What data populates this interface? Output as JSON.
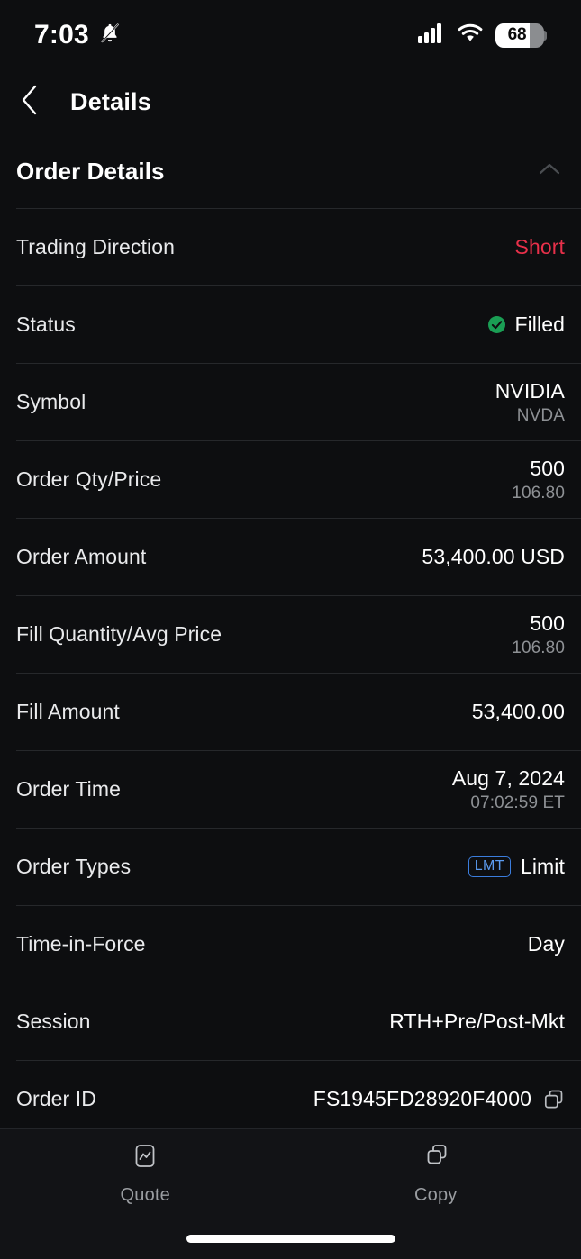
{
  "status_bar": {
    "time": "7:03",
    "bell_icon": "bell-muted-icon",
    "signal_icon": "cellular-signal-icon",
    "wifi_icon": "wifi-icon",
    "battery_percent": "68"
  },
  "nav": {
    "back_icon": "chevron-left-icon",
    "title": "Details"
  },
  "section": {
    "title": "Order Details",
    "collapse_icon": "chevron-up-icon"
  },
  "colors": {
    "background": "#0d0e10",
    "short_red": "#e8304a",
    "filled_green": "#1a9e54",
    "badge_blue": "#5b9bf0",
    "divider": "#26282b",
    "subvalue_gray": "#8e9195"
  },
  "rows": [
    {
      "label": "Trading Direction",
      "value": "Short",
      "sub": "",
      "style": "short"
    },
    {
      "label": "Status",
      "value": "Filled",
      "sub": "",
      "style": "status",
      "icon": "check-circle-icon"
    },
    {
      "label": "Symbol",
      "value": "NVIDIA",
      "sub": "NVDA",
      "style": "plain"
    },
    {
      "label": "Order Qty/Price",
      "value": "500",
      "sub": "106.80",
      "style": "plain"
    },
    {
      "label": "Order Amount",
      "value": "53,400.00 USD",
      "sub": "",
      "style": "plain"
    },
    {
      "label": "Fill Quantity/Avg Price",
      "value": "500",
      "sub": "106.80",
      "style": "plain"
    },
    {
      "label": "Fill Amount",
      "value": "53,400.00",
      "sub": "",
      "style": "plain"
    },
    {
      "label": "Order Time",
      "value": "Aug 7, 2024",
      "sub": "07:02:59 ET",
      "style": "plain"
    },
    {
      "label": "Order Types",
      "value": "Limit",
      "sub": "",
      "style": "badge",
      "badge": "LMT"
    },
    {
      "label": "Time-in-Force",
      "value": "Day",
      "sub": "",
      "style": "plain"
    },
    {
      "label": "Session",
      "value": "RTH+Pre/Post-Mkt",
      "sub": "",
      "style": "plain"
    },
    {
      "label": "Order ID",
      "value": "FS1945FD28920F4000",
      "sub": "",
      "style": "copy",
      "icon": "copy-icon"
    }
  ],
  "bottom_bar": {
    "tabs": [
      {
        "label": "Quote",
        "icon": "quote-chart-icon"
      },
      {
        "label": "Copy",
        "icon": "copy-icon"
      }
    ]
  }
}
